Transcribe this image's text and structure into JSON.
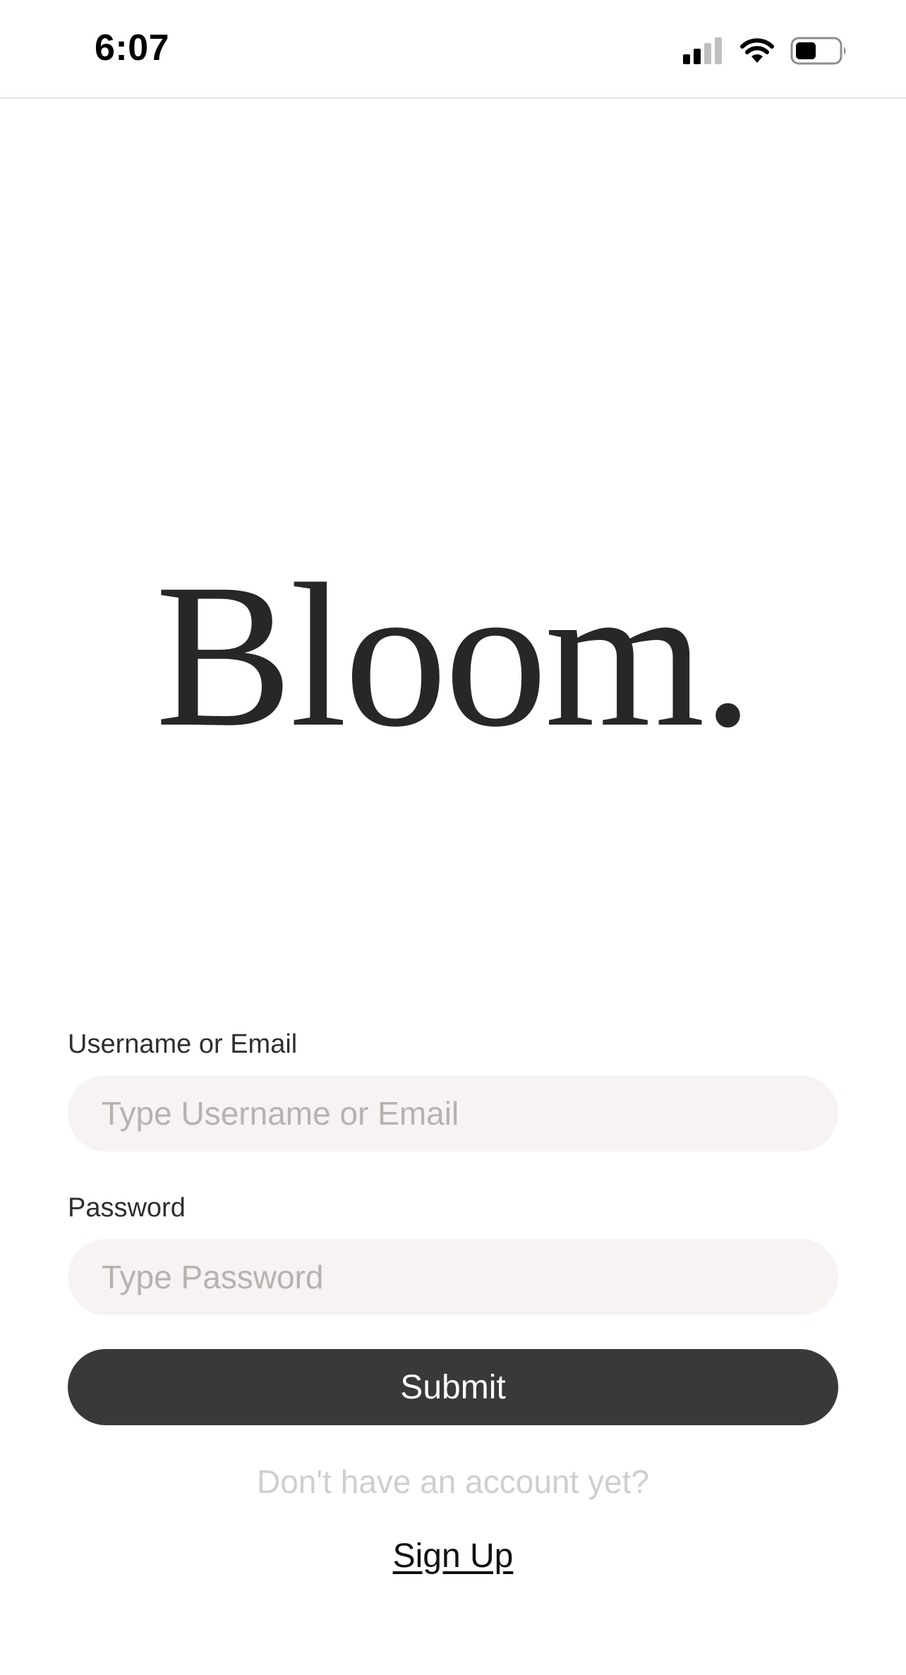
{
  "status_bar": {
    "time": "6:07",
    "icons": [
      "cellular-signal-icon",
      "wifi-icon",
      "battery-icon"
    ]
  },
  "logo": {
    "text": "Bloom."
  },
  "login_form": {
    "username_label": "Username or Email",
    "username_placeholder": "Type Username or Email",
    "username_value": "",
    "password_label": "Password",
    "password_placeholder": "Type Password",
    "password_value": "",
    "submit_label": "Submit"
  },
  "signup": {
    "prompt": "Don't have an account yet?",
    "link_label": "Sign Up"
  },
  "colors": {
    "input_background": "#f6f3f2",
    "button_background": "#393939",
    "logo_text": "#272727",
    "muted_text": "#cfcfcf"
  }
}
